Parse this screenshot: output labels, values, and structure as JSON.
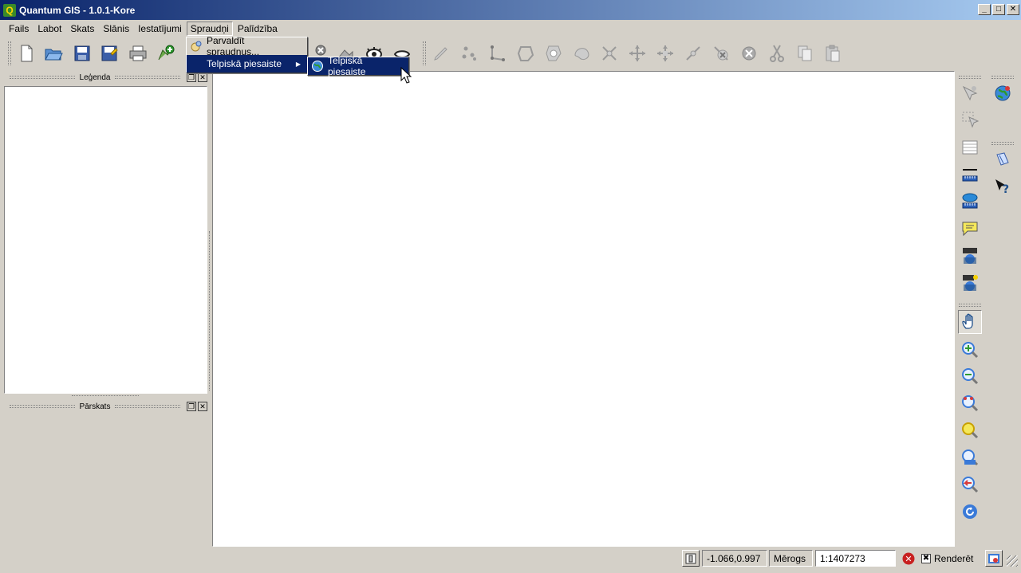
{
  "window": {
    "title": "Quantum GIS - 1.0.1-Kore",
    "app_icon_glyph": "Q"
  },
  "menubar": {
    "items": [
      {
        "id": "fails",
        "label": "Fails"
      },
      {
        "id": "labot",
        "label": "Labot"
      },
      {
        "id": "skats",
        "label": "Skats"
      },
      {
        "id": "slanis",
        "label": "Slānis"
      },
      {
        "id": "iestatijumi",
        "label": "Iestatījumi"
      },
      {
        "id": "spraudni",
        "label": "Spraudņi"
      },
      {
        "id": "palidziba",
        "label": "Palīdzība"
      }
    ],
    "active": "Spraudņi"
  },
  "plugins_menu": {
    "items": [
      {
        "label": "Parvaldīt spraudņus...",
        "icon": "plugin-manager-icon"
      },
      {
        "label": "Telpiskā piesaiste",
        "icon": "submenu-arrow-icon",
        "submenu": true
      }
    ]
  },
  "submenu": {
    "items": [
      {
        "label": "Telpiskā piesaiste",
        "icon": "georeferencer-globe-icon"
      }
    ]
  },
  "legend_panel": {
    "title": "Leģenda",
    "float_glyph": "❐",
    "close_glyph": "✕"
  },
  "overview_panel": {
    "title": "Pārskats",
    "float_glyph": "❐",
    "close_glyph": "✕"
  },
  "statusbar": {
    "coordinates": "-1.066,0.997",
    "scale_label": "Mērogs",
    "scale_value": "1:1407273",
    "render_label": "Renderēt",
    "render_checked": true,
    "stop_glyph": "✕"
  },
  "colors": {
    "title_start": "#0a246a",
    "title_end": "#a6caf0",
    "highlight": "#0a246a",
    "face": "#d4d0c8"
  }
}
